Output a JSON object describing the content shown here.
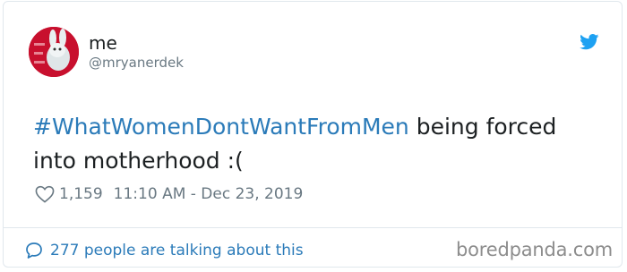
{
  "tweet": {
    "author_name": "me",
    "author_handle": "@mryanerdek",
    "hashtag": "#WhatWomenDontWantFromMen",
    "text_rest": " being forced into motherhood :(",
    "likes": "1,159",
    "timestamp": "11:10 AM - Dec 23, 2019"
  },
  "footer": {
    "talk_label": "277 people are talking about this"
  },
  "watermark": "boredpanda.com",
  "icons": {
    "logo": "twitter-bird-icon",
    "like": "heart-icon",
    "reply": "speech-bubble-icon"
  },
  "colors": {
    "link": "#2b7bb9",
    "twitter_blue": "#1da1f2",
    "muted": "#697882",
    "border": "#e1e8ed"
  }
}
